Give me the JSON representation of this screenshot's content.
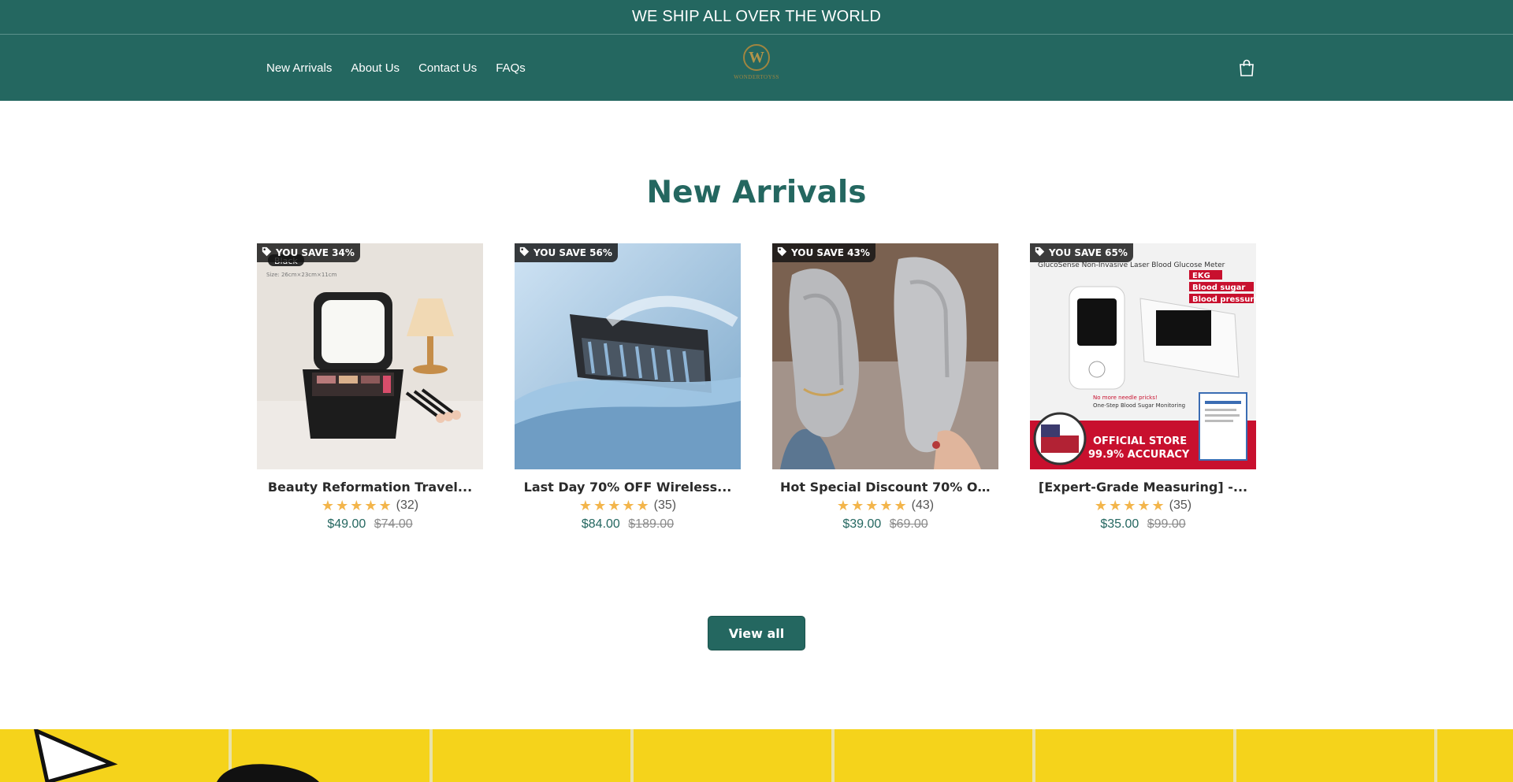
{
  "announcement": {
    "text": "WE SHIP ALL OVER THE WORLD"
  },
  "nav": {
    "items": [
      "New Arrivals",
      "About Us",
      "Contact Us",
      "FAQs"
    ]
  },
  "logo": {
    "letter": "W",
    "text": "WONDERTOYSS"
  },
  "cart": {
    "icon": "shopping-bag-icon"
  },
  "main": {
    "title": "New Arrivals",
    "view_all": "View all",
    "products": [
      {
        "badge": "YOU SAVE 34%",
        "title": "Beauty Reformation Travel...",
        "rating_count": "(32)",
        "price": "$49.00",
        "compare": "$74.00"
      },
      {
        "badge": "YOU SAVE 56%",
        "title": "Last Day 70% OFF Wireless...",
        "rating_count": "(35)",
        "price": "$84.00",
        "compare": "$189.00"
      },
      {
        "badge": "YOU SAVE 43%",
        "title": "Hot Special Discount 70% OFF...",
        "rating_count": "(43)",
        "price": "$39.00",
        "compare": "$69.00"
      },
      {
        "badge": "YOU SAVE 65%",
        "title": "[Expert-Grade Measuring] -...",
        "rating_count": "(35)",
        "price": "$35.00",
        "compare": "$99.00"
      }
    ],
    "image_texts": {
      "p1_label": "Black",
      "p1_size": "Size: 26cm×23cm×11cm",
      "p4_header": "GlucoSense Non-Invasive Laser Blood Glucose Meter",
      "p4_tag1": "EKG",
      "p4_tag2": "Blood sugar",
      "p4_tag3": "Blood pressure",
      "p4_note1": "No more needle pricks!",
      "p4_note2": "One-Step Blood Sugar Monitoring",
      "p4_footer1": "OFFICIAL STORE",
      "p4_footer2": "99.9% ACCURACY"
    }
  },
  "colors": {
    "brand": "#246760",
    "price": "#246760",
    "star": "#f3b54b",
    "banner": "#f5d31b"
  }
}
